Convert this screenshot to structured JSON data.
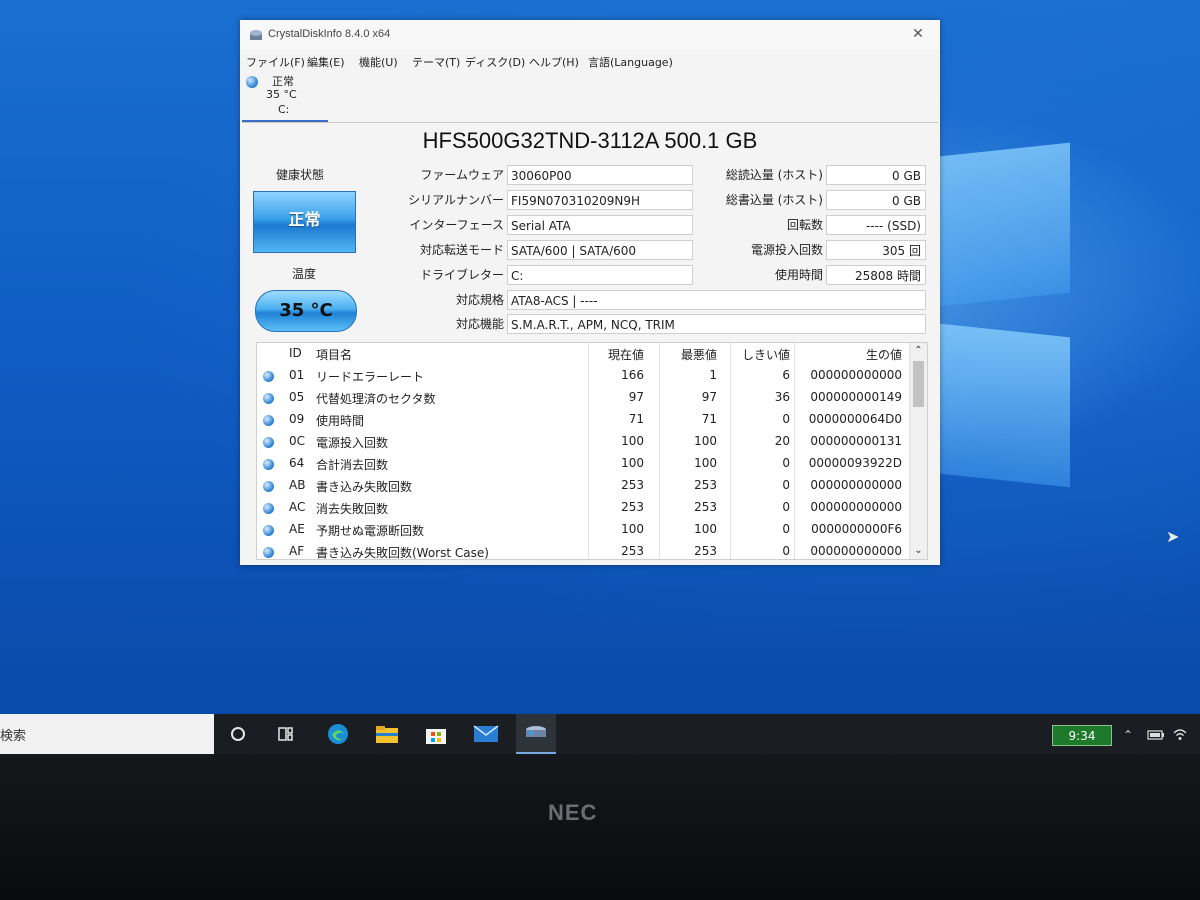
{
  "window": {
    "title": "CrystalDiskInfo 8.4.0 x64",
    "close_glyph": "✕",
    "menu": [
      "ファイル(F)",
      "編集(E)",
      "機能(U)",
      "テーマ(T)",
      "ディスク(D)",
      "ヘルプ(H)",
      "言語(Language)"
    ],
    "drive_tab": {
      "status": "正常",
      "temp": "35 °C",
      "letter": "C:"
    },
    "model": "HFS500G32TND-3112A 500.1 GB",
    "health_label": "健康状態",
    "health_value": "正常",
    "temp_label": "温度",
    "temp_value": "35 °C",
    "fields": {
      "firmware_label": "ファームウェア",
      "firmware": "30060P00",
      "serial_label": "シリアルナンバー",
      "serial": "FI59N070310209N9H",
      "interface_label": "インターフェース",
      "interface": "Serial ATA",
      "transfer_label": "対応転送モード",
      "transfer": "SATA/600 | SATA/600",
      "drive_letter_label": "ドライブレター",
      "drive_letter": "C:",
      "standard_label": "対応規格",
      "standard": "ATA8-ACS | ----",
      "features_label": "対応機能",
      "features": "S.M.A.R.T., APM, NCQ, TRIM",
      "host_reads_label": "総読込量 (ホスト)",
      "host_reads": "0 GB",
      "host_writes_label": "総書込量 (ホスト)",
      "host_writes": "0 GB",
      "rotation_label": "回転数",
      "rotation": "---- (SSD)",
      "power_on_count_label": "電源投入回数",
      "power_on_count": "305 回",
      "power_on_hours_label": "使用時間",
      "power_on_hours": "25808 時間"
    },
    "smart": {
      "headers": {
        "id": "ID",
        "name": "項目名",
        "current": "現在値",
        "worst": "最悪値",
        "threshold": "しきい値",
        "raw": "生の値"
      },
      "rows": [
        {
          "id": "01",
          "name": "リードエラーレート",
          "current": "166",
          "worst": "1",
          "threshold": "6",
          "raw": "000000000000"
        },
        {
          "id": "05",
          "name": "代替処理済のセクタ数",
          "current": "97",
          "worst": "97",
          "threshold": "36",
          "raw": "000000000149"
        },
        {
          "id": "09",
          "name": "使用時間",
          "current": "71",
          "worst": "71",
          "threshold": "0",
          "raw": "0000000064D0"
        },
        {
          "id": "0C",
          "name": "電源投入回数",
          "current": "100",
          "worst": "100",
          "threshold": "20",
          "raw": "000000000131"
        },
        {
          "id": "64",
          "name": "合計消去回数",
          "current": "100",
          "worst": "100",
          "threshold": "0",
          "raw": "00000093922D"
        },
        {
          "id": "AB",
          "name": "書き込み失敗回数",
          "current": "253",
          "worst": "253",
          "threshold": "0",
          "raw": "000000000000"
        },
        {
          "id": "AC",
          "name": "消去失敗回数",
          "current": "253",
          "worst": "253",
          "threshold": "0",
          "raw": "000000000000"
        },
        {
          "id": "AE",
          "name": "予期せぬ電源断回数",
          "current": "100",
          "worst": "100",
          "threshold": "0",
          "raw": "0000000000F6"
        },
        {
          "id": "AF",
          "name": "書き込み失敗回数(Worst Case)",
          "current": "253",
          "worst": "253",
          "threshold": "0",
          "raw": "000000000000"
        }
      ],
      "scroll_up": "⌃",
      "scroll_down": "⌄"
    }
  },
  "taskbar": {
    "search_text": "検索",
    "clock": "9:34",
    "icons": [
      "cortana-circle-icon",
      "task-view-icon",
      "edge-icon",
      "file-explorer-icon",
      "store-icon",
      "mail-icon",
      "crystaldiskinfo-icon"
    ]
  },
  "bezel": {
    "brand": "NEC"
  }
}
